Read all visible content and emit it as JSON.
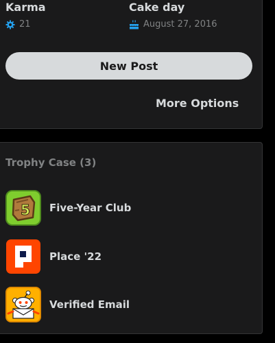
{
  "stats": {
    "karma": {
      "label": "Karma",
      "value": "21"
    },
    "cake_day": {
      "label": "Cake day",
      "value": "August 27, 2016"
    }
  },
  "actions": {
    "new_post": "New Post",
    "more_options": "More Options"
  },
  "trophy_case": {
    "title": "Trophy Case (3)",
    "trophies": [
      {
        "name": "Five-Year Club",
        "icon": "five-year-club-icon"
      },
      {
        "name": "Place '22",
        "icon": "place-22-icon"
      },
      {
        "name": "Verified Email",
        "icon": "verified-email-icon"
      }
    ]
  },
  "colors": {
    "background": "#000000",
    "card": "#1a1a1b",
    "border": "#343536",
    "text": "#d7dadc",
    "muted": "#818384",
    "accent": "#24a0ed"
  }
}
